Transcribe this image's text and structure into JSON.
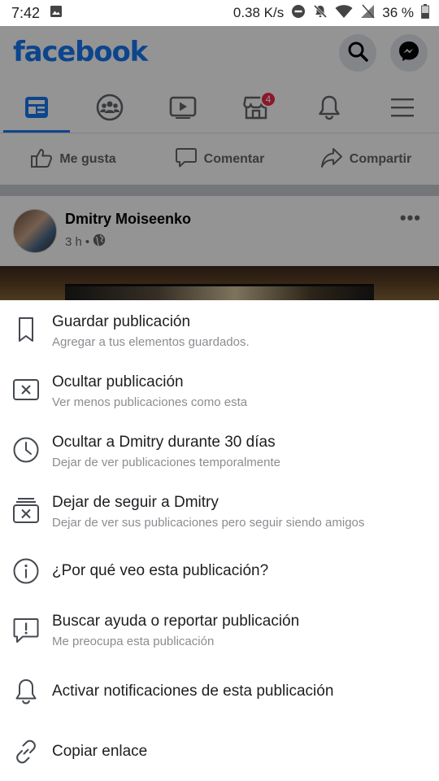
{
  "status_bar": {
    "time": "7:42",
    "network_speed": "0.38 K/s",
    "battery": "36 %"
  },
  "header": {
    "logo_text": "facebook",
    "brand_color": "#1877f2"
  },
  "tabs": [
    {
      "name": "home",
      "icon": "news-feed-icon",
      "active": true
    },
    {
      "name": "groups",
      "icon": "groups-icon",
      "active": false
    },
    {
      "name": "watch",
      "icon": "video-icon",
      "active": false
    },
    {
      "name": "marketplace",
      "icon": "marketplace-icon",
      "active": false,
      "badge": "4"
    },
    {
      "name": "notifications",
      "icon": "bell-icon",
      "active": false
    },
    {
      "name": "menu",
      "icon": "hamburger-menu-icon",
      "active": false
    }
  ],
  "post_actions": {
    "like": "Me gusta",
    "comment": "Comentar",
    "share": "Compartir"
  },
  "post": {
    "author": "Dmitry Moiseenko",
    "time": "3 h",
    "separator": "•",
    "more": "•••"
  },
  "sheet": {
    "items": [
      {
        "icon": "bookmark-icon",
        "title": "Guardar publicación",
        "subtitle": "Agregar a tus elementos guardados."
      },
      {
        "icon": "hide-x-icon",
        "title": "Ocultar publicación",
        "subtitle": "Ver menos publicaciones como esta"
      },
      {
        "icon": "clock-icon",
        "title": "Ocultar a Dmitry durante 30 días",
        "subtitle": "Dejar de ver publicaciones temporalmente"
      },
      {
        "icon": "unfollow-icon",
        "title": "Dejar de seguir a Dmitry",
        "subtitle": "Dejar de ver sus publicaciones pero seguir siendo amigos"
      },
      {
        "icon": "info-icon",
        "title": "¿Por qué veo esta publicación?",
        "subtitle": ""
      },
      {
        "icon": "report-icon",
        "title": "Buscar ayuda o reportar publicación",
        "subtitle": "Me preocupa esta publicación"
      },
      {
        "icon": "bell-icon",
        "title": "Activar notificaciones de esta publicación",
        "subtitle": ""
      },
      {
        "icon": "link-icon",
        "title": "Copiar enlace",
        "subtitle": ""
      }
    ]
  }
}
